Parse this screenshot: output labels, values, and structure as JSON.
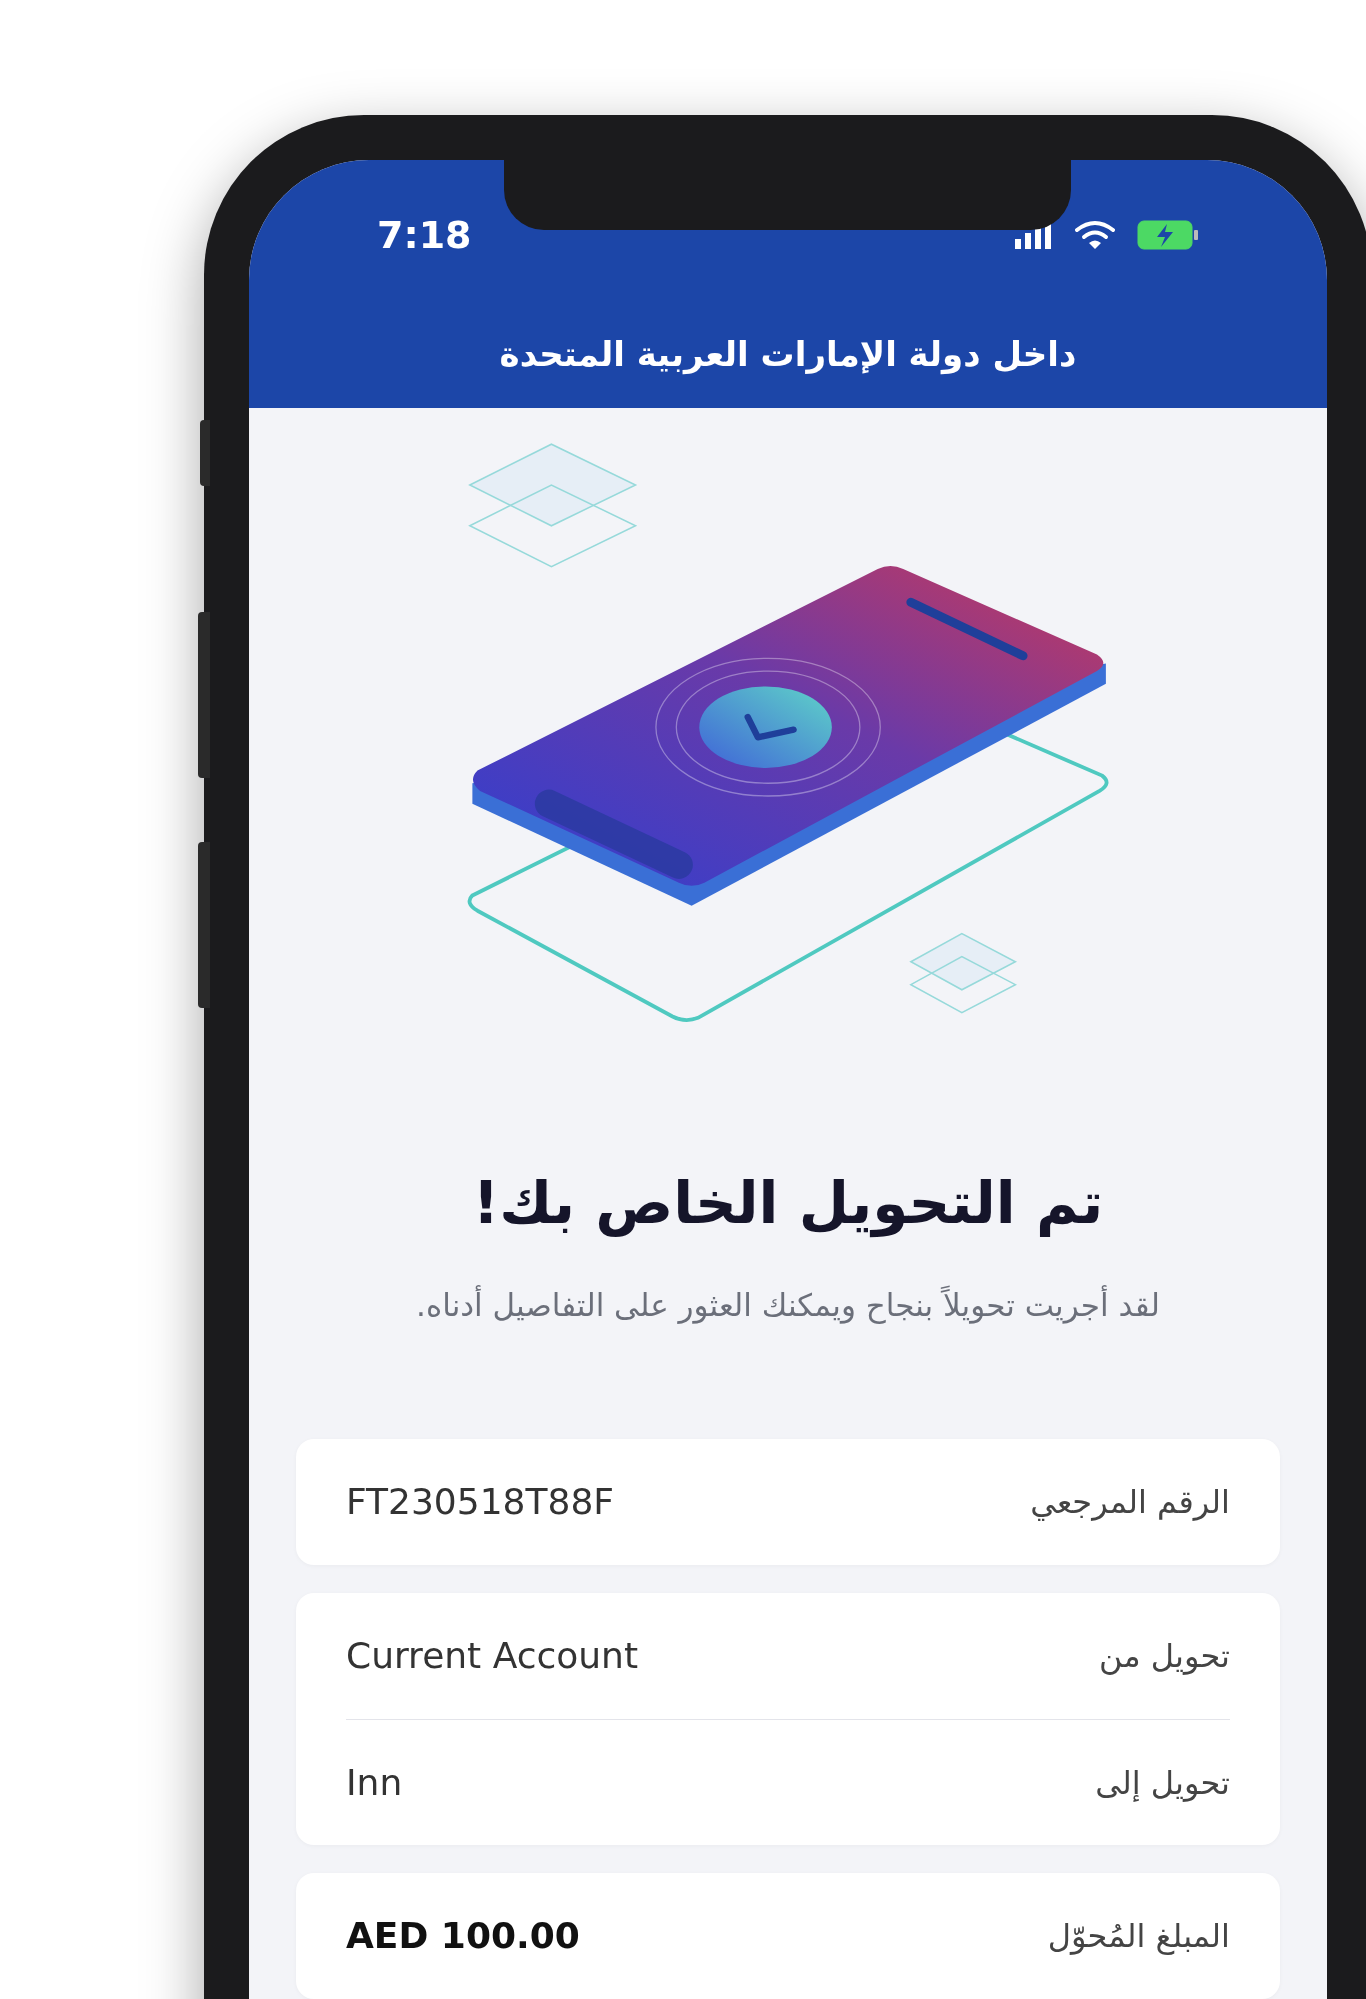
{
  "status_bar": {
    "time": "7:18"
  },
  "header": {
    "title": "داخل دولة الإمارات العربية المتحدة"
  },
  "result": {
    "title": "تم التحويل الخاص بك!",
    "message": "لقد أجريت تحويلاً بنجاح ويمكنك العثور على التفاصيل أدناه."
  },
  "details": [
    {
      "rows": [
        {
          "label": "الرقم المرجعي",
          "value": "FT230518T88F",
          "emphasis": false
        }
      ]
    },
    {
      "rows": [
        {
          "label": "تحويل من",
          "value": "Current Account",
          "emphasis": false
        },
        {
          "label": "تحويل إلى",
          "value": "Inn",
          "emphasis": false
        }
      ]
    },
    {
      "rows": [
        {
          "label": "المبلغ المُحوّل",
          "value": "AED 100.00",
          "emphasis": true
        }
      ]
    }
  ]
}
